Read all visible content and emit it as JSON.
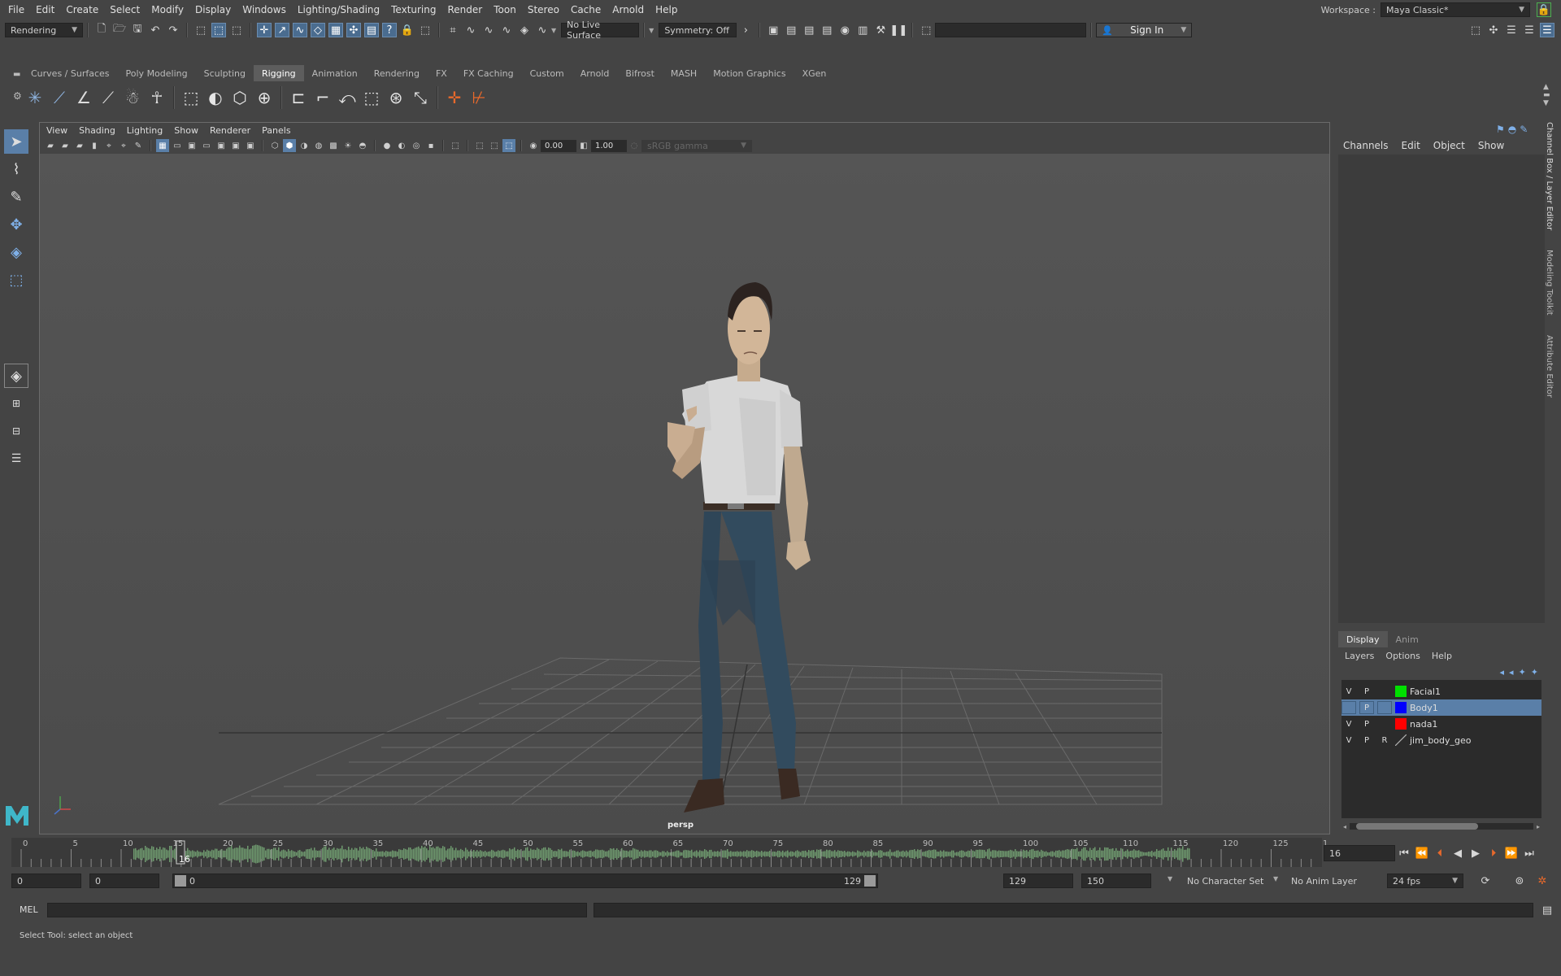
{
  "menu": [
    "File",
    "Edit",
    "Create",
    "Select",
    "Modify",
    "Display",
    "Windows",
    "Lighting/Shading",
    "Texturing",
    "Render",
    "Toon",
    "Stereo",
    "Cache",
    "Arnold",
    "Help"
  ],
  "workspace": {
    "label": "Workspace :",
    "value": "Maya Classic*"
  },
  "status": {
    "mode": "Rendering",
    "live_surface": "No Live Surface",
    "symmetry": "Symmetry: Off",
    "sign_in": "Sign In"
  },
  "shelf_tabs": [
    "Curves / Surfaces",
    "Poly Modeling",
    "Sculpting",
    "Rigging",
    "Animation",
    "Rendering",
    "FX",
    "FX Caching",
    "Custom",
    "Arnold",
    "Bifrost",
    "MASH",
    "Motion Graphics",
    "XGen"
  ],
  "shelf_active": "Rigging",
  "viewport": {
    "menu": [
      "View",
      "Shading",
      "Lighting",
      "Show",
      "Renderer",
      "Panels"
    ],
    "exposure": "0.00",
    "gamma": "1.00",
    "color_space": "sRGB gamma",
    "camera_label": "persp"
  },
  "channel_box": {
    "menu": [
      "Channels",
      "Edit",
      "Object",
      "Show"
    ]
  },
  "side_tabs": [
    "Channel Box / Layer Editor",
    "Modeling Toolkit",
    "Attribute Editor"
  ],
  "layer_editor": {
    "tabs": [
      "Display",
      "Anim"
    ],
    "menu": [
      "Layers",
      "Options",
      "Help"
    ],
    "layers": [
      {
        "v": "V",
        "p": "P",
        "r": "",
        "color": "#00e000",
        "name": "Facial1",
        "selected": false
      },
      {
        "v": "",
        "p": "P",
        "r": "",
        "color": "#0000ff",
        "name": "Body1",
        "selected": true
      },
      {
        "v": "V",
        "p": "P",
        "r": "",
        "color": "#ff0000",
        "name": "nada1",
        "selected": false
      },
      {
        "v": "V",
        "p": "P",
        "r": "R",
        "color": "",
        "name": "jim_body_geo",
        "selected": false
      }
    ]
  },
  "timeline": {
    "ticks": [
      "0",
      "5",
      "10",
      "15",
      "20",
      "25",
      "30",
      "35",
      "40",
      "45",
      "50",
      "55",
      "60",
      "65",
      "70",
      "75",
      "80",
      "85",
      "90",
      "95",
      "100",
      "105",
      "110",
      "115",
      "120",
      "125",
      "1"
    ],
    "current_frame_marker": "16",
    "current_frame": "16"
  },
  "range": {
    "anim_start": "0",
    "playback_start": "0",
    "slider_start": "0",
    "slider_end": "129",
    "playback_end": "129",
    "anim_end": "150",
    "character_set": "No Character Set",
    "anim_layer": "No Anim Layer",
    "fps": "24 fps"
  },
  "command_line": {
    "label": "MEL"
  },
  "help_line": "Select Tool: select an object"
}
